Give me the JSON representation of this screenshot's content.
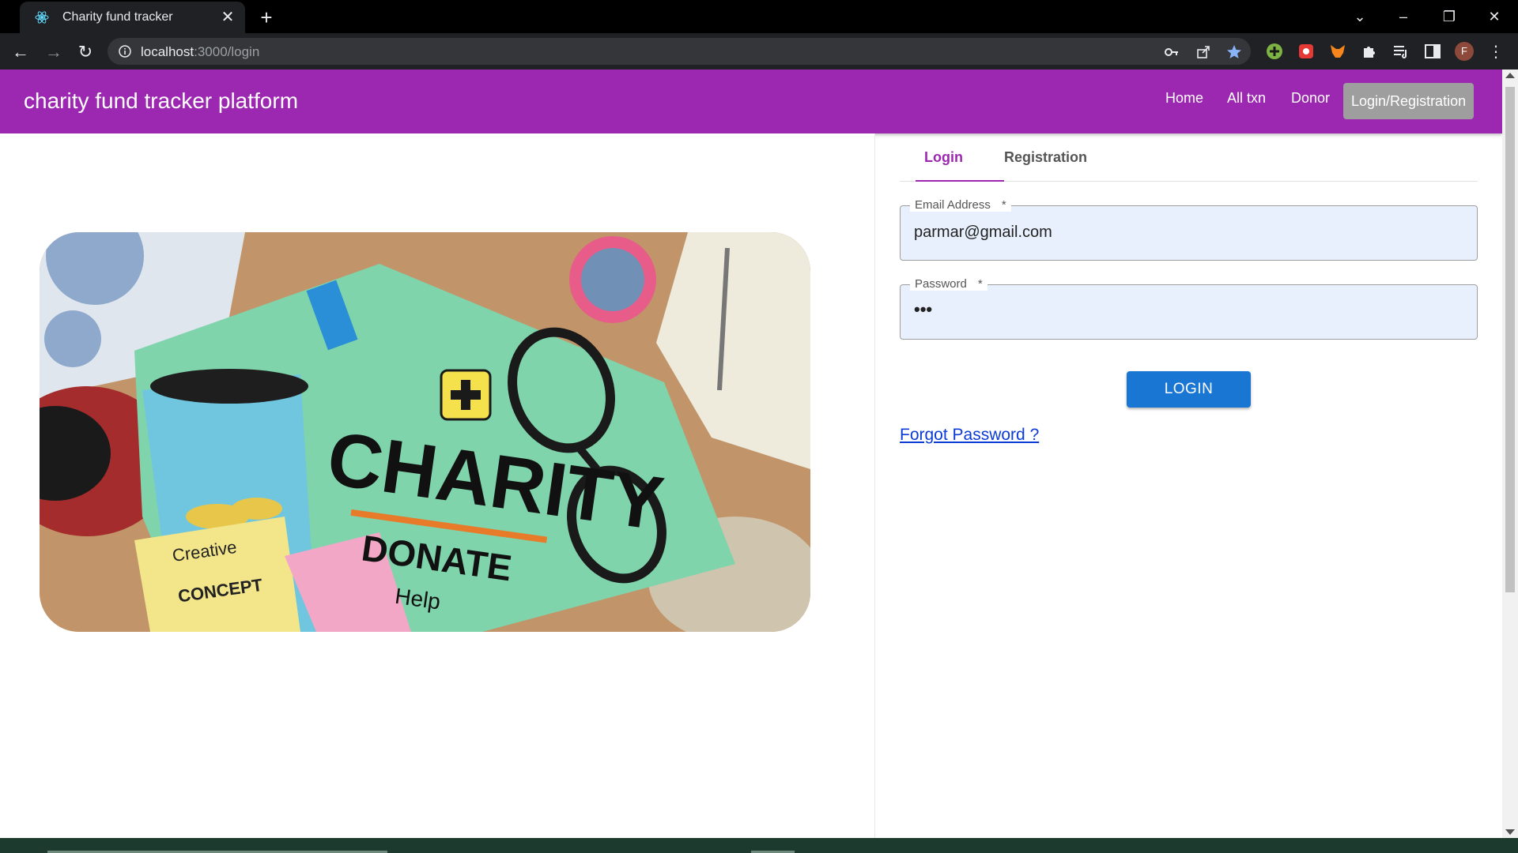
{
  "browser": {
    "tab_title": "Charity fund tracker",
    "url_host": "localhost",
    "url_path": ":3000/login",
    "profile_initial": "F"
  },
  "app": {
    "brand": "charity fund tracker platform",
    "nav": [
      "Home",
      "All txn",
      "Donor",
      "Login/Registration"
    ],
    "accent_color": "#9c27b0"
  },
  "auth": {
    "tabs": [
      "Login",
      "Registration"
    ],
    "email_label": "Email Address",
    "email_required": "*",
    "email_value": "parmar@gmail.com",
    "password_label": "Password",
    "password_required": "*",
    "password_value": "•••",
    "login_button": "LOGIN",
    "forgot_link": "Forgot Password ?"
  },
  "hero": {
    "headline": "CHARITY",
    "subheadline": "DONATE",
    "help": "Help",
    "note_1": "Creative",
    "note_2": "CONCEPT"
  }
}
